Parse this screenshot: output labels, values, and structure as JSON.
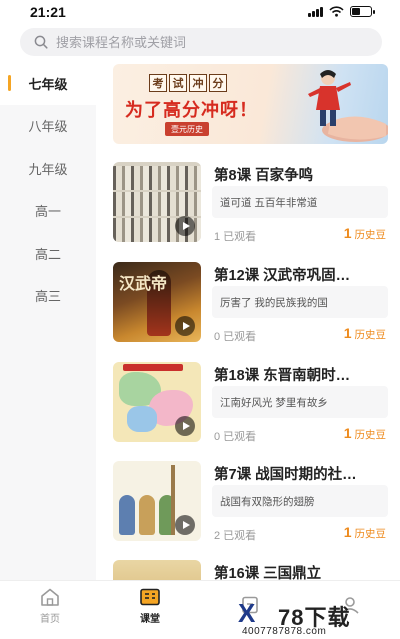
{
  "status_bar": {
    "time": "21:21"
  },
  "search": {
    "placeholder": "搜索课程名称或关键词"
  },
  "sidebar": {
    "grades": [
      {
        "label": "七年级",
        "active": true
      },
      {
        "label": "八年级",
        "active": false
      },
      {
        "label": "九年级",
        "active": false
      },
      {
        "label": "高一",
        "active": false
      },
      {
        "label": "高二",
        "active": false
      },
      {
        "label": "高三",
        "active": false
      }
    ]
  },
  "banner": {
    "tag_chars": [
      "考",
      "试",
      "冲",
      "分"
    ],
    "slogan": "为了高分冲呀！",
    "brand": "壹元历史"
  },
  "courses": [
    {
      "title": "第8课 百家争鸣",
      "desc": "道可道  五百年非常道",
      "views": "1 已观看",
      "price": "1",
      "unit": "历史豆"
    },
    {
      "title": "第12课 汉武帝巩固…",
      "desc": "厉害了 我的民族我的国",
      "views": "0 已观看",
      "price": "1",
      "unit": "历史豆"
    },
    {
      "title": "第18课 东晋南朝时…",
      "desc": "江南好风光 梦里有故乡",
      "views": "0 已观看",
      "price": "1",
      "unit": "历史豆"
    },
    {
      "title": "第7课 战国时期的社…",
      "desc": "战国有双隐形的翅膀",
      "views": "2 已观看",
      "price": "1",
      "unit": "历史豆"
    },
    {
      "title": "第16课 三国鼎立",
      "desc": "",
      "views": "",
      "price": "",
      "unit": ""
    }
  ],
  "thumb_text": {
    "course2": "汉武帝"
  },
  "bottom_nav": {
    "items": [
      {
        "label": "首页",
        "icon": "home-icon",
        "active": false
      },
      {
        "label": "课堂",
        "icon": "classroom-icon",
        "active": true
      },
      {
        "label": "",
        "icon": "tab-icon",
        "active": false
      },
      {
        "label": "",
        "icon": "profile-icon",
        "active": false
      }
    ]
  },
  "watermark": {
    "logo": "X",
    "title": "78下载",
    "site": "4007787878.com"
  },
  "colors": {
    "accent": "#f5a524",
    "price": "#ee8a1c",
    "slogan": "#d62b1f"
  }
}
